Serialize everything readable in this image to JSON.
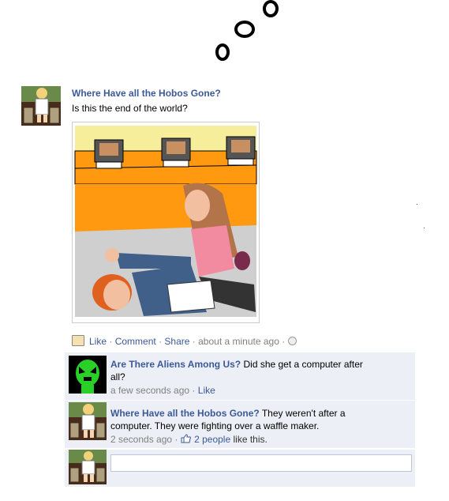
{
  "post": {
    "author": "Where Have all the Hobos Gone?",
    "text": "Is this the end of the world?",
    "actions": {
      "like": "Like",
      "comment": "Comment",
      "share": "Share",
      "timestamp": "about a minute ago",
      "sep": "·"
    }
  },
  "comments": [
    {
      "author": "Are There Aliens Among Us?",
      "text": "Did she get a computer after all?",
      "time": "a few seconds ago",
      "like": "Like"
    },
    {
      "author": "Where Have all the Hobos Gone?",
      "text": "They weren't after a computer. They were fighting over a waffle maker.",
      "time": "2 seconds ago",
      "likes_link": "2 people",
      "likes_suffix": "like this."
    }
  ],
  "compose": {
    "placeholder": ""
  },
  "icons": {
    "ping": "ping-icon",
    "globe": "globe-icon",
    "thumbs_up": "thumbs-up-icon"
  },
  "colors": {
    "link": "#3b5998",
    "comment_bg": "#eceff5",
    "muted": "#808080"
  }
}
